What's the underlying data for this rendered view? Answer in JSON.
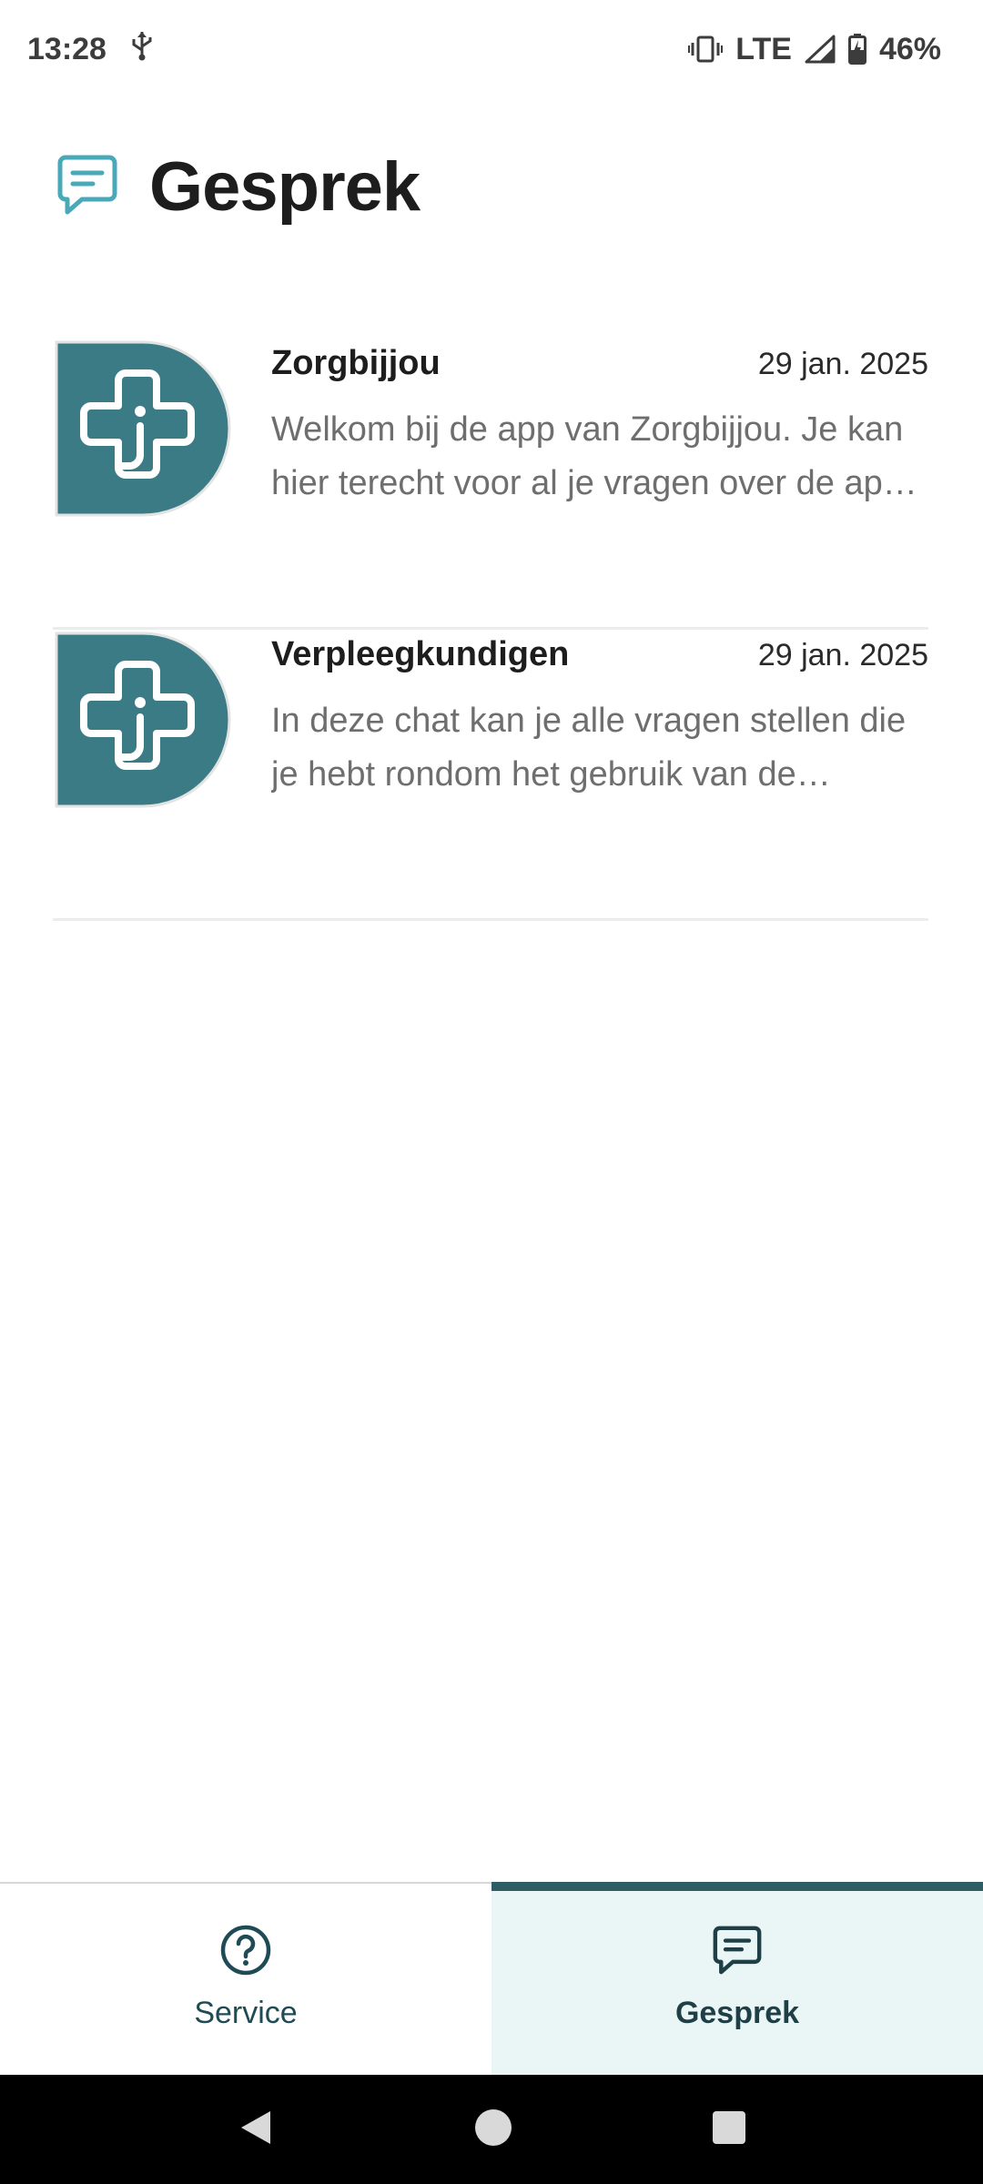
{
  "status_bar": {
    "time": "13:28",
    "network": "LTE",
    "battery": "46%",
    "icons": [
      "usb-icon",
      "vibrate-icon",
      "signal-icon",
      "battery-icon"
    ]
  },
  "header": {
    "title": "Gesprek",
    "icon": "chat-icon"
  },
  "conversations": [
    {
      "name": "Zorgbijjou",
      "date": "29 jan. 2025",
      "preview": "Welkom bij de app van Zorgbijjou. Je kan hier terecht voor al je vragen over de app en je behandeling.",
      "avatar": "zorgbijjou-logo"
    },
    {
      "name": "Verpleegkundigen",
      "date": "29 jan. 2025",
      "preview": "In deze chat kan je alle vragen stellen die je hebt rondom het gebruik van de medische apparatuur.",
      "avatar": "zorgbijjou-logo"
    }
  ],
  "bottom_nav": {
    "tabs": [
      {
        "label": "Service",
        "icon": "help-circle-icon",
        "active": false
      },
      {
        "label": "Gesprek",
        "icon": "chat-icon",
        "active": true
      }
    ]
  },
  "colors": {
    "brand_teal": "#3b7b85",
    "accent_teal_light": "#4aa9b8",
    "active_tab_bg": "#eaf6f5",
    "active_tab_indicator": "#2f5d66"
  }
}
